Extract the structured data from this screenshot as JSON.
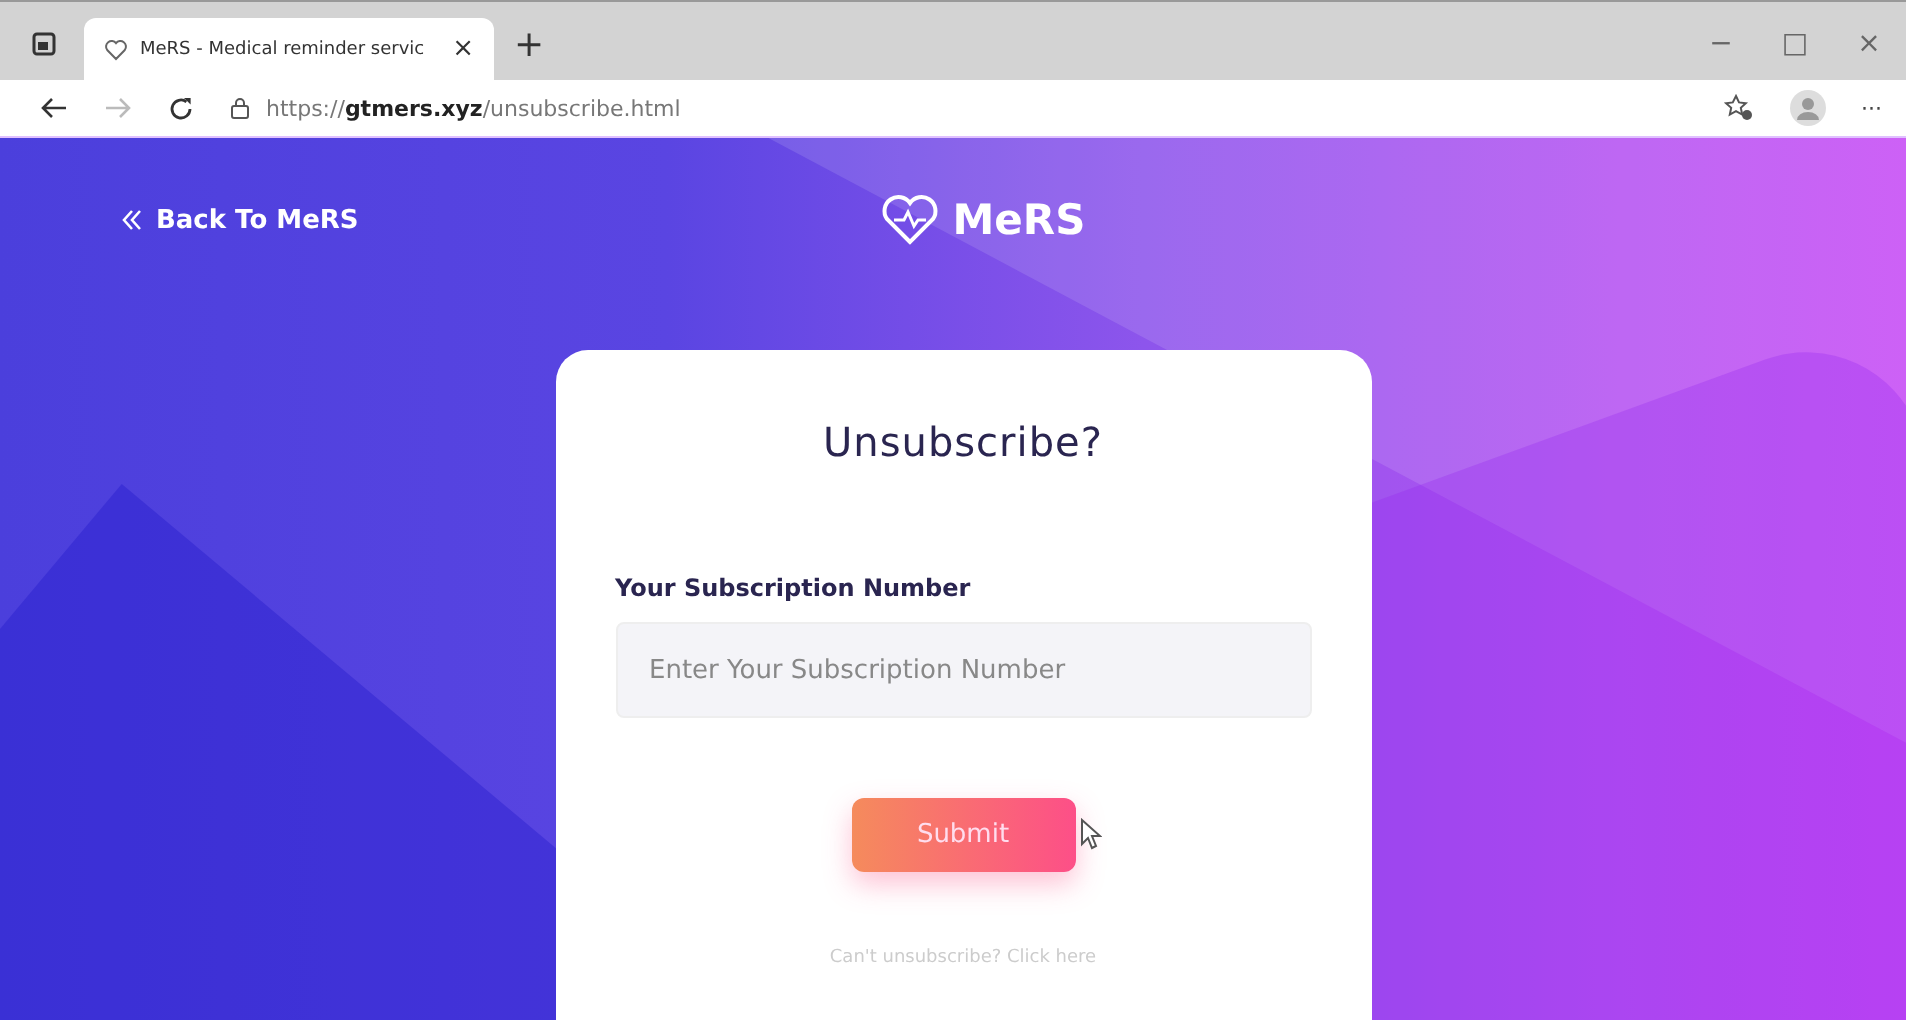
{
  "browser": {
    "tab_title": "MeRS - Medical reminder servic",
    "tab_close": "×",
    "new_tab": "+",
    "url_scheme": "https://",
    "url_host": "gtmers.xyz",
    "url_path": "/unsubscribe.html",
    "window_controls": [
      "−",
      "□",
      "×"
    ],
    "menu": "···"
  },
  "header": {
    "back_link": "Back To MeRS",
    "logo_text": "MeRS"
  },
  "card": {
    "title": "Unsubscribe?",
    "field_label": "Your Subscription Number",
    "field": {
      "placeholder": "Enter Your Subscription Number"
    },
    "submit": "Submit",
    "help_link": "Can't unsubscribe? Click here"
  }
}
